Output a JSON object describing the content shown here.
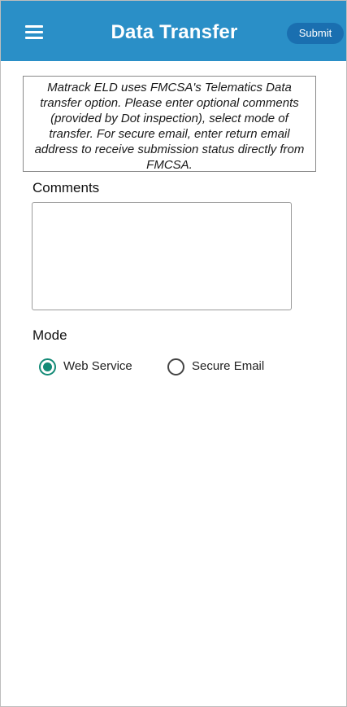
{
  "colors": {
    "app_bar": "#2a8fc7",
    "submit_button": "#1a6fb0",
    "radio_selected": "#138a76"
  },
  "header": {
    "menu_icon": "hamburger-menu-icon",
    "title": "Data Transfer",
    "submit_label": "Submit"
  },
  "info": {
    "text": "Matrack ELD uses FMCSA's Telematics Data transfer option. Please enter optional comments (provided by Dot inspection), select mode of transfer. For secure email, enter return email address to receive submission status directly from FMCSA."
  },
  "comments": {
    "label": "Comments",
    "value": ""
  },
  "mode": {
    "label": "Mode",
    "selected": "Web Service",
    "options": [
      {
        "label": "Web Service"
      },
      {
        "label": "Secure Email"
      }
    ]
  }
}
